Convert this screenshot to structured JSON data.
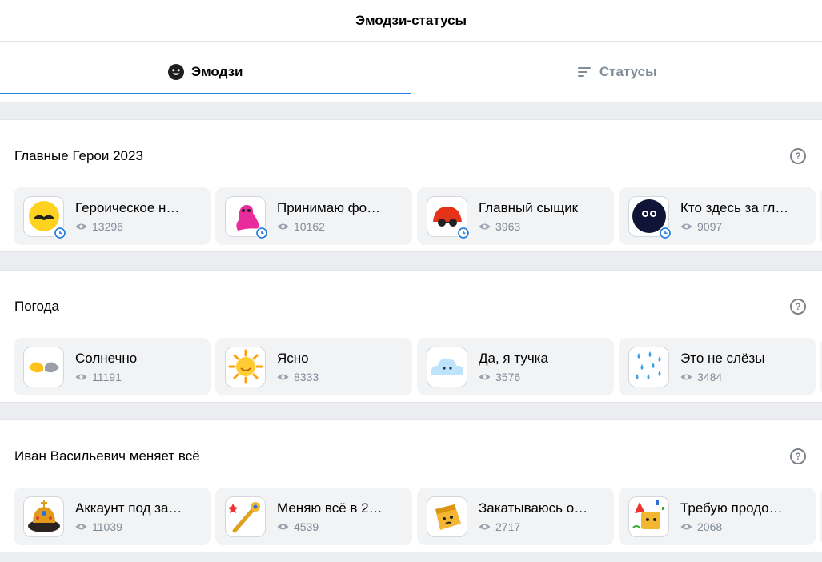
{
  "header": {
    "title": "Эмодзи-статусы"
  },
  "tabs": [
    {
      "label": "Эмодзи",
      "icon": "smile-icon",
      "active": true
    },
    {
      "label": "Статусы",
      "icon": "list-icon",
      "active": false
    }
  ],
  "sections": [
    {
      "title": "Главные Герои 2023",
      "items": [
        {
          "title": "Героическое н…",
          "views": "13296",
          "icon": "mustache-face-emoji",
          "timed": true
        },
        {
          "title": "Принимаю фо…",
          "views": "10162",
          "icon": "pink-blob-emoji",
          "timed": true
        },
        {
          "title": "Главный сыщик",
          "views": "3963",
          "icon": "detective-emoji",
          "timed": true
        },
        {
          "title": "Кто здесь за гл…",
          "views": "9097",
          "icon": "dark-ball-emoji",
          "timed": true
        }
      ]
    },
    {
      "title": "Погода",
      "items": [
        {
          "title": "Солнечно",
          "views": "11191",
          "icon": "sun-hands-emoji",
          "timed": false
        },
        {
          "title": "Ясно",
          "views": "8333",
          "icon": "sun-emoji",
          "timed": false
        },
        {
          "title": "Да, я тучка",
          "views": "3576",
          "icon": "cloud-emoji",
          "timed": false
        },
        {
          "title": "Это не слёзы",
          "views": "3484",
          "icon": "raindrops-emoji",
          "timed": false
        }
      ]
    },
    {
      "title": "Иван Васильевич меняет всё",
      "items": [
        {
          "title": "Аккаунт под за…",
          "views": "11039",
          "icon": "crown-emoji",
          "timed": false
        },
        {
          "title": "Меняю всё в 2…",
          "views": "4539",
          "icon": "scepter-emoji",
          "timed": false
        },
        {
          "title": "Закатываюсь о…",
          "views": "2717",
          "icon": "box-face-emoji",
          "timed": false
        },
        {
          "title": "Требую продо…",
          "views": "2068",
          "icon": "party-emoji",
          "timed": false
        }
      ]
    }
  ],
  "colors": {
    "accent": "#2d81e0",
    "secondary_text": "#818c99",
    "card_bg": "#f2f3f5",
    "page_bg": "#ebedf0"
  }
}
